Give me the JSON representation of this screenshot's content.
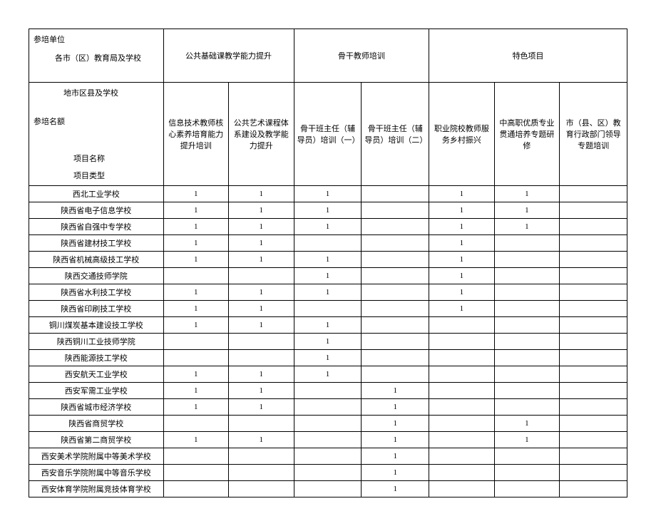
{
  "chart_data": {
    "type": "table",
    "top_left": {
      "unit": "参培单位",
      "subunits": "各市（区）教育局及学校",
      "subsub": "地市区县及学校",
      "quota": "参培名额",
      "project": "项目名称",
      "types": "项目类型"
    },
    "groups": [
      {
        "label": "公共基础课教学能力提升",
        "span": 2
      },
      {
        "label": "骨干教师培训",
        "span": 2
      },
      {
        "label": "特色项目",
        "span": 3
      }
    ],
    "programs": [
      "信息技术教师核心素养培育能力提升培训",
      "公共艺术课程体系建设及教学能力提升",
      "骨干班主任（辅导员）培训（一）",
      "骨干班主任（辅导员）培训（二）",
      "职业院校教师服务乡村振兴",
      "中高职优质专业贯通培养专题研修",
      "市（县、区）教育行政部门领导专题培训"
    ],
    "rows": [
      {
        "label": "西北工业学校",
        "vals": [
          "1",
          "1",
          "1",
          "",
          "1",
          "1",
          ""
        ]
      },
      {
        "label": "陕西省电子信息学校",
        "vals": [
          "1",
          "1",
          "1",
          "",
          "1",
          "1",
          ""
        ]
      },
      {
        "label": "陕西省自强中专学校",
        "vals": [
          "1",
          "1",
          "1",
          "",
          "1",
          "1",
          ""
        ]
      },
      {
        "label": "陕西省建材技工学校",
        "vals": [
          "1",
          "1",
          "",
          "",
          "1",
          "",
          ""
        ]
      },
      {
        "label": "陕西省机械高级技工学校",
        "vals": [
          "1",
          "1",
          "1",
          "",
          "1",
          "",
          ""
        ]
      },
      {
        "label": "陕西交通技师学院",
        "vals": [
          "",
          "",
          "1",
          "",
          "1",
          "",
          ""
        ]
      },
      {
        "label": "陕西省水利技工学校",
        "vals": [
          "1",
          "1",
          "1",
          "",
          "1",
          "",
          ""
        ]
      },
      {
        "label": "陕西省印刷技工学校",
        "vals": [
          "1",
          "1",
          "",
          "",
          "1",
          "",
          ""
        ]
      },
      {
        "label": "铜川煤炭基本建设技工学校",
        "vals": [
          "1",
          "1",
          "1",
          "",
          "",
          "",
          ""
        ]
      },
      {
        "label": "陕西铜川工业技师学院",
        "vals": [
          "",
          "",
          "1",
          "",
          "",
          "",
          ""
        ]
      },
      {
        "label": "陕西能源技工学校",
        "vals": [
          "",
          "",
          "1",
          "",
          "",
          "",
          ""
        ]
      },
      {
        "label": "西安航天工业学校",
        "vals": [
          "1",
          "1",
          "1",
          "",
          "",
          "",
          ""
        ]
      },
      {
        "label": "西安军需工业学校",
        "vals": [
          "1",
          "1",
          "",
          "1",
          "",
          "",
          ""
        ]
      },
      {
        "label": "陕西省城市经济学校",
        "vals": [
          "1",
          "1",
          "",
          "1",
          "",
          "",
          ""
        ]
      },
      {
        "label": "陕西省商贸学校",
        "vals": [
          "",
          "",
          "",
          "1",
          "",
          "1",
          ""
        ]
      },
      {
        "label": "陕西省第二商贸学校",
        "vals": [
          "1",
          "1",
          "",
          "1",
          "",
          "1",
          ""
        ]
      },
      {
        "label": "西安美术学院附属中等美术学校",
        "vals": [
          "",
          "",
          "",
          "1",
          "",
          "",
          ""
        ]
      },
      {
        "label": "西安音乐学院附属中等音乐学校",
        "vals": [
          "",
          "",
          "",
          "1",
          "",
          "",
          ""
        ]
      },
      {
        "label": "西安体育学院附属竞技体育学校",
        "vals": [
          "",
          "",
          "",
          "1",
          "",
          "",
          ""
        ]
      }
    ]
  }
}
